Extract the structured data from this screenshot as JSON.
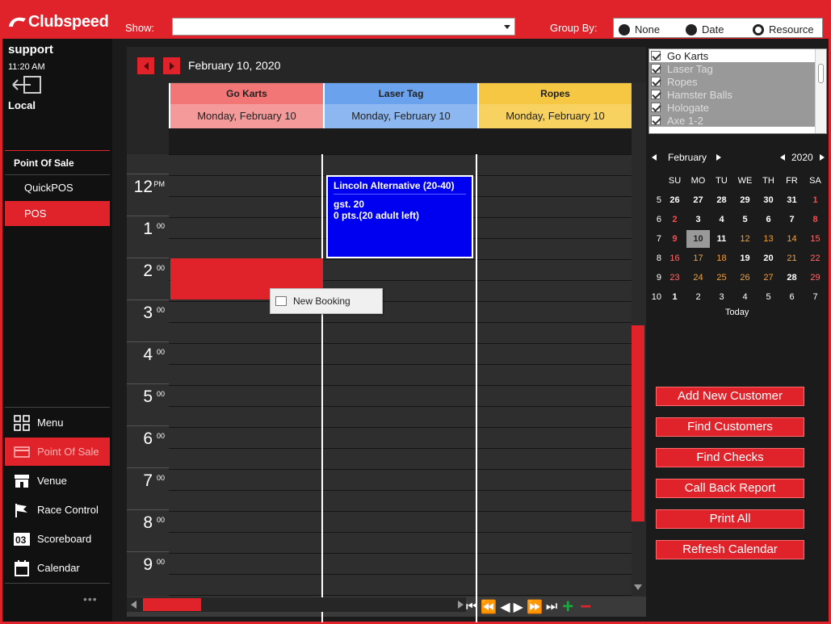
{
  "brand": {
    "name": "Clubspeed"
  },
  "toolbar": {
    "show_label": "Show:",
    "show_value": "",
    "group_label": "Group By:",
    "group_options": [
      "None",
      "Date",
      "Resource"
    ],
    "group_selected": "Resource"
  },
  "sidebar": {
    "user": "support",
    "time": "11:20 AM",
    "location": "Local",
    "section": "Point Of Sale",
    "sub_items": [
      {
        "label": "QuickPOS"
      },
      {
        "label": "POS"
      }
    ],
    "nav": [
      {
        "label": "Menu",
        "icon": "grid-icon"
      },
      {
        "label": "Point Of Sale",
        "icon": "card-icon"
      },
      {
        "label": "Venue",
        "icon": "store-icon"
      },
      {
        "label": "Race Control",
        "icon": "flag-icon"
      },
      {
        "label": "Scoreboard",
        "icon": "scoreboard-icon"
      },
      {
        "label": "Calendar",
        "icon": "calendar-icon"
      }
    ],
    "more": "•••"
  },
  "calendar": {
    "date_title": "February 10, 2020",
    "resources": [
      {
        "name": "Go Karts",
        "date": "Monday, February 10",
        "color": "#f27676",
        "date_color": "#f49a9a"
      },
      {
        "name": "Laser Tag",
        "date": "Monday, February 10",
        "color": "#6aa2ee",
        "date_color": "#8db7f0"
      },
      {
        "name": "Ropes",
        "date": "Monday, February 10",
        "color": "#f6c742",
        "date_color": "#f8d260"
      }
    ],
    "hours": [
      {
        "h": "12",
        "m": "PM"
      },
      {
        "h": "1",
        "m": "00"
      },
      {
        "h": "2",
        "m": "00"
      },
      {
        "h": "3",
        "m": "00"
      },
      {
        "h": "4",
        "m": "00"
      },
      {
        "h": "5",
        "m": "00"
      },
      {
        "h": "6",
        "m": "00"
      },
      {
        "h": "7",
        "m": "00"
      },
      {
        "h": "8",
        "m": "00"
      },
      {
        "h": "9",
        "m": "00"
      }
    ],
    "booking": {
      "title": "Lincoln Alternative (20-40)",
      "line1": "gst. 20",
      "line2": "0 pts.(20 adult left)"
    },
    "context_menu": {
      "item": "New Booking"
    }
  },
  "resource_filter": [
    {
      "label": "Go Karts",
      "checked": true
    },
    {
      "label": "Laser Tag",
      "checked": true
    },
    {
      "label": "Ropes",
      "checked": true
    },
    {
      "label": "Hamster Balls",
      "checked": true
    },
    {
      "label": "Hologate",
      "checked": true
    },
    {
      "label": "Axe 1-2",
      "checked": true
    }
  ],
  "mini_calendar": {
    "month": "February",
    "year": "2020",
    "today_label": "Today",
    "weekdays": [
      "SU",
      "MO",
      "TU",
      "WE",
      "TH",
      "FR",
      "SA"
    ],
    "weeks": [
      {
        "wk": "5",
        "days": [
          "26",
          "27",
          "28",
          "29",
          "30",
          "31",
          "1"
        ]
      },
      {
        "wk": "6",
        "days": [
          "2",
          "3",
          "4",
          "5",
          "6",
          "7",
          "8"
        ]
      },
      {
        "wk": "7",
        "days": [
          "9",
          "10",
          "11",
          "12",
          "13",
          "14",
          "15"
        ]
      },
      {
        "wk": "8",
        "days": [
          "16",
          "17",
          "18",
          "19",
          "20",
          "21",
          "22"
        ]
      },
      {
        "wk": "9",
        "days": [
          "23",
          "24",
          "25",
          "26",
          "27",
          "28",
          "29"
        ]
      },
      {
        "wk": "10",
        "days": [
          "1",
          "2",
          "3",
          "4",
          "5",
          "6",
          "7"
        ]
      }
    ],
    "selected": "10"
  },
  "actions": [
    "Add New Customer",
    "Find Customers",
    "Find Checks",
    "Call Back Report",
    "Print All",
    "Refresh Calendar"
  ],
  "colors": {
    "accent": "#e0232b",
    "booking": "#0000f0",
    "dark": "#1b1b1b"
  }
}
